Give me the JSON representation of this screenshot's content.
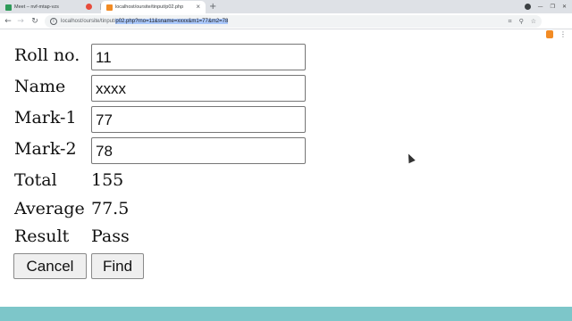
{
  "browser": {
    "tabs": [
      {
        "title": "Meet – nvf-mtap-vzs",
        "active": false
      },
      {
        "title": "localhost/oursite/tinput/p02.php",
        "active": true
      }
    ],
    "new_tab_symbol": "+",
    "url_host": "localhost/oursite/tinput/",
    "url_path": "p02.php?rno=11&sname=xxxx&m1=77&m2=78",
    "accent_colors": {
      "selection": "#aac8fb",
      "bottom_bar": "#7dc6c9"
    }
  },
  "form": {
    "fields": [
      {
        "label": "Roll no.",
        "value": "11"
      },
      {
        "label": "Name",
        "value": "xxxx"
      },
      {
        "label": "Mark-1",
        "value": "77"
      },
      {
        "label": "Mark-2",
        "value": "78"
      }
    ],
    "results": [
      {
        "label": "Total",
        "value": "155"
      },
      {
        "label": "Average",
        "value": "77.5"
      },
      {
        "label": "Result",
        "value": "Pass"
      }
    ],
    "buttons": {
      "cancel": "Cancel",
      "find": "Find"
    }
  },
  "icons": [
    "back-icon",
    "forward-icon",
    "reload-icon",
    "info-icon",
    "qr-icon",
    "zoom-icon",
    "star-icon",
    "extension-icon",
    "menu-icon",
    "mouse-cursor-icon"
  ]
}
